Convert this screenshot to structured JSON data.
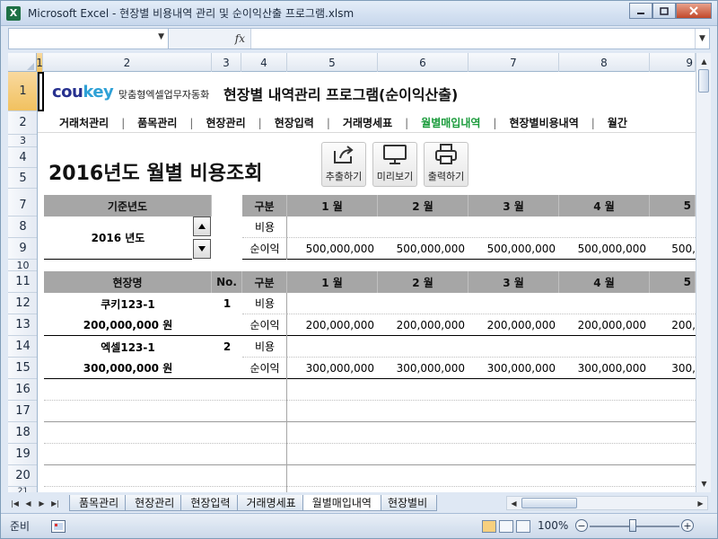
{
  "window": {
    "title": "Microsoft Excel - 현장별 비용내역 관리 및 순이익산출 프로그램.xlsm",
    "app_icon": "X",
    "colors": {
      "accent_green": "#1a9b3b",
      "header_gray": "#a6a6a6",
      "logo_blue": "#27318f"
    }
  },
  "formula_bar": {
    "fx_label": "fx",
    "name_box": "",
    "formula": ""
  },
  "columns": [
    "1",
    "2",
    "3",
    "4",
    "5",
    "6",
    "7",
    "8",
    "9"
  ],
  "rows": [
    "1",
    "2",
    "3",
    "4",
    "5",
    "7",
    "8",
    "9",
    "10",
    "11",
    "12",
    "13",
    "14",
    "15",
    "16",
    "17",
    "18",
    "19",
    "20",
    "21"
  ],
  "header": {
    "logo_main": "cou",
    "logo_key": "key",
    "logo_sub": "맞춤형엑셀업무자동화",
    "program_title": "현장별 내역관리 프로그램(순이익산출)"
  },
  "nav": {
    "items": [
      {
        "label": "거래처관리"
      },
      {
        "label": "품목관리"
      },
      {
        "label": "현장관리"
      },
      {
        "label": "현장입력"
      },
      {
        "label": "거래명세표"
      },
      {
        "label": "월별매입내역"
      },
      {
        "label": "현장별비용내역"
      },
      {
        "label": "월간"
      }
    ],
    "separator": "|"
  },
  "page": {
    "title": "2016년도 월별 비용조회",
    "buttons": {
      "export": "추출하기",
      "preview": "미리보기",
      "print": "출력하기"
    }
  },
  "year_box": {
    "label": "기준년도",
    "value": "2016 년도"
  },
  "summary": {
    "header": [
      "구분",
      "1 월",
      "2 월",
      "3 월",
      "4 월",
      "5"
    ],
    "rows": [
      {
        "label": "비용",
        "values": [
          "",
          "",
          "",
          "",
          ""
        ]
      },
      {
        "label": "순이익",
        "values": [
          "500,000,000",
          "500,000,000",
          "500,000,000",
          "500,000,000",
          "500,"
        ]
      }
    ]
  },
  "sites": {
    "header": {
      "name": "현장명",
      "no": "No.",
      "kind": "구분",
      "months": [
        "1 월",
        "2 월",
        "3 월",
        "4 월",
        "5"
      ]
    },
    "items": [
      {
        "name": "쿠키123-1",
        "total": "200,000,000 원",
        "no": "1",
        "cost_label": "비용",
        "profit_label": "순이익",
        "cost": [
          "",
          "",
          "",
          "",
          ""
        ],
        "profit": [
          "200,000,000",
          "200,000,000",
          "200,000,000",
          "200,000,000",
          "200,"
        ]
      },
      {
        "name": "엑셀123-1",
        "total": "300,000,000 원",
        "no": "2",
        "cost_label": "비용",
        "profit_label": "순이익",
        "cost": [
          "",
          "",
          "",
          "",
          ""
        ],
        "profit": [
          "300,000,000",
          "300,000,000",
          "300,000,000",
          "300,000,000",
          "300,"
        ]
      }
    ]
  },
  "sheet_tabs": [
    "품목관리",
    "현장관리",
    "현장입력",
    "거래명세표",
    "월별매입내역",
    "현장별비"
  ],
  "active_tab": "월별매입내역",
  "status": {
    "mode": "준비",
    "zoom": "100%"
  }
}
